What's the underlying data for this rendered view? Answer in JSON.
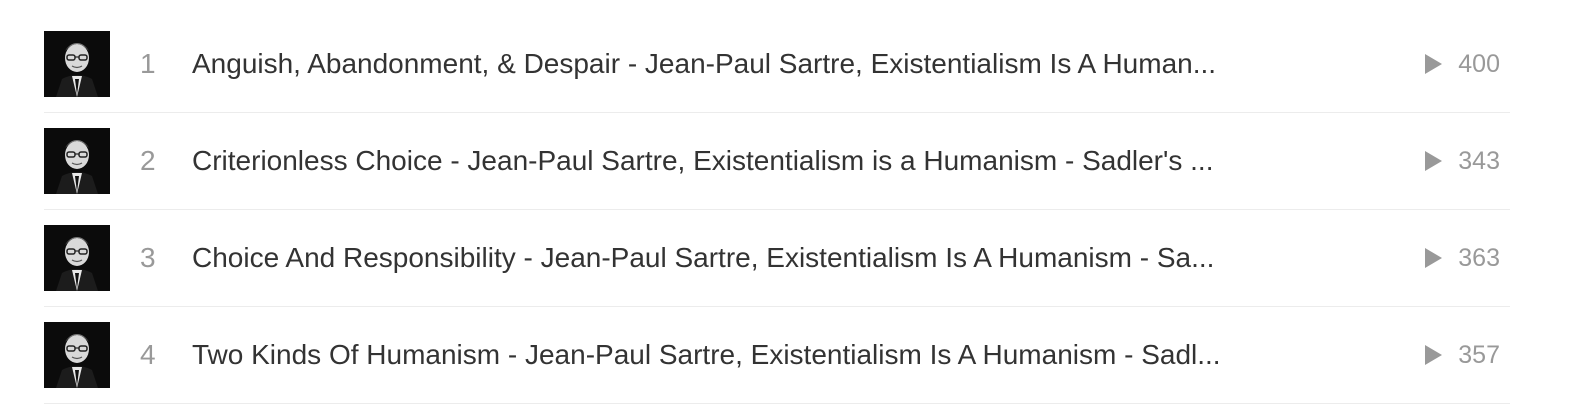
{
  "tracks": [
    {
      "number": "1",
      "title": "Anguish, Abandonment, & Despair - Jean-Paul Sartre, Existentialism Is A Human...",
      "plays": "400",
      "artwork_icon": "portrait-thumbnail"
    },
    {
      "number": "2",
      "title": "Criterionless Choice - Jean-Paul Sartre, Existentialism is a Humanism - Sadler's ...",
      "plays": "343",
      "artwork_icon": "portrait-thumbnail"
    },
    {
      "number": "3",
      "title": "Choice And Responsibility - Jean-Paul Sartre, Existentialism Is A Humanism - Sa...",
      "plays": "363",
      "artwork_icon": "portrait-thumbnail"
    },
    {
      "number": "4",
      "title": "Two Kinds Of Humanism - Jean-Paul Sartre, Existentialism Is A Humanism - Sadl...",
      "plays": "357",
      "artwork_icon": "portrait-thumbnail"
    }
  ],
  "icons": {
    "plays": "play-count-icon"
  },
  "colors": {
    "text": "#333333",
    "muted": "#999999",
    "divider": "#ececec",
    "artwork_bg": "#0b0b0b"
  }
}
